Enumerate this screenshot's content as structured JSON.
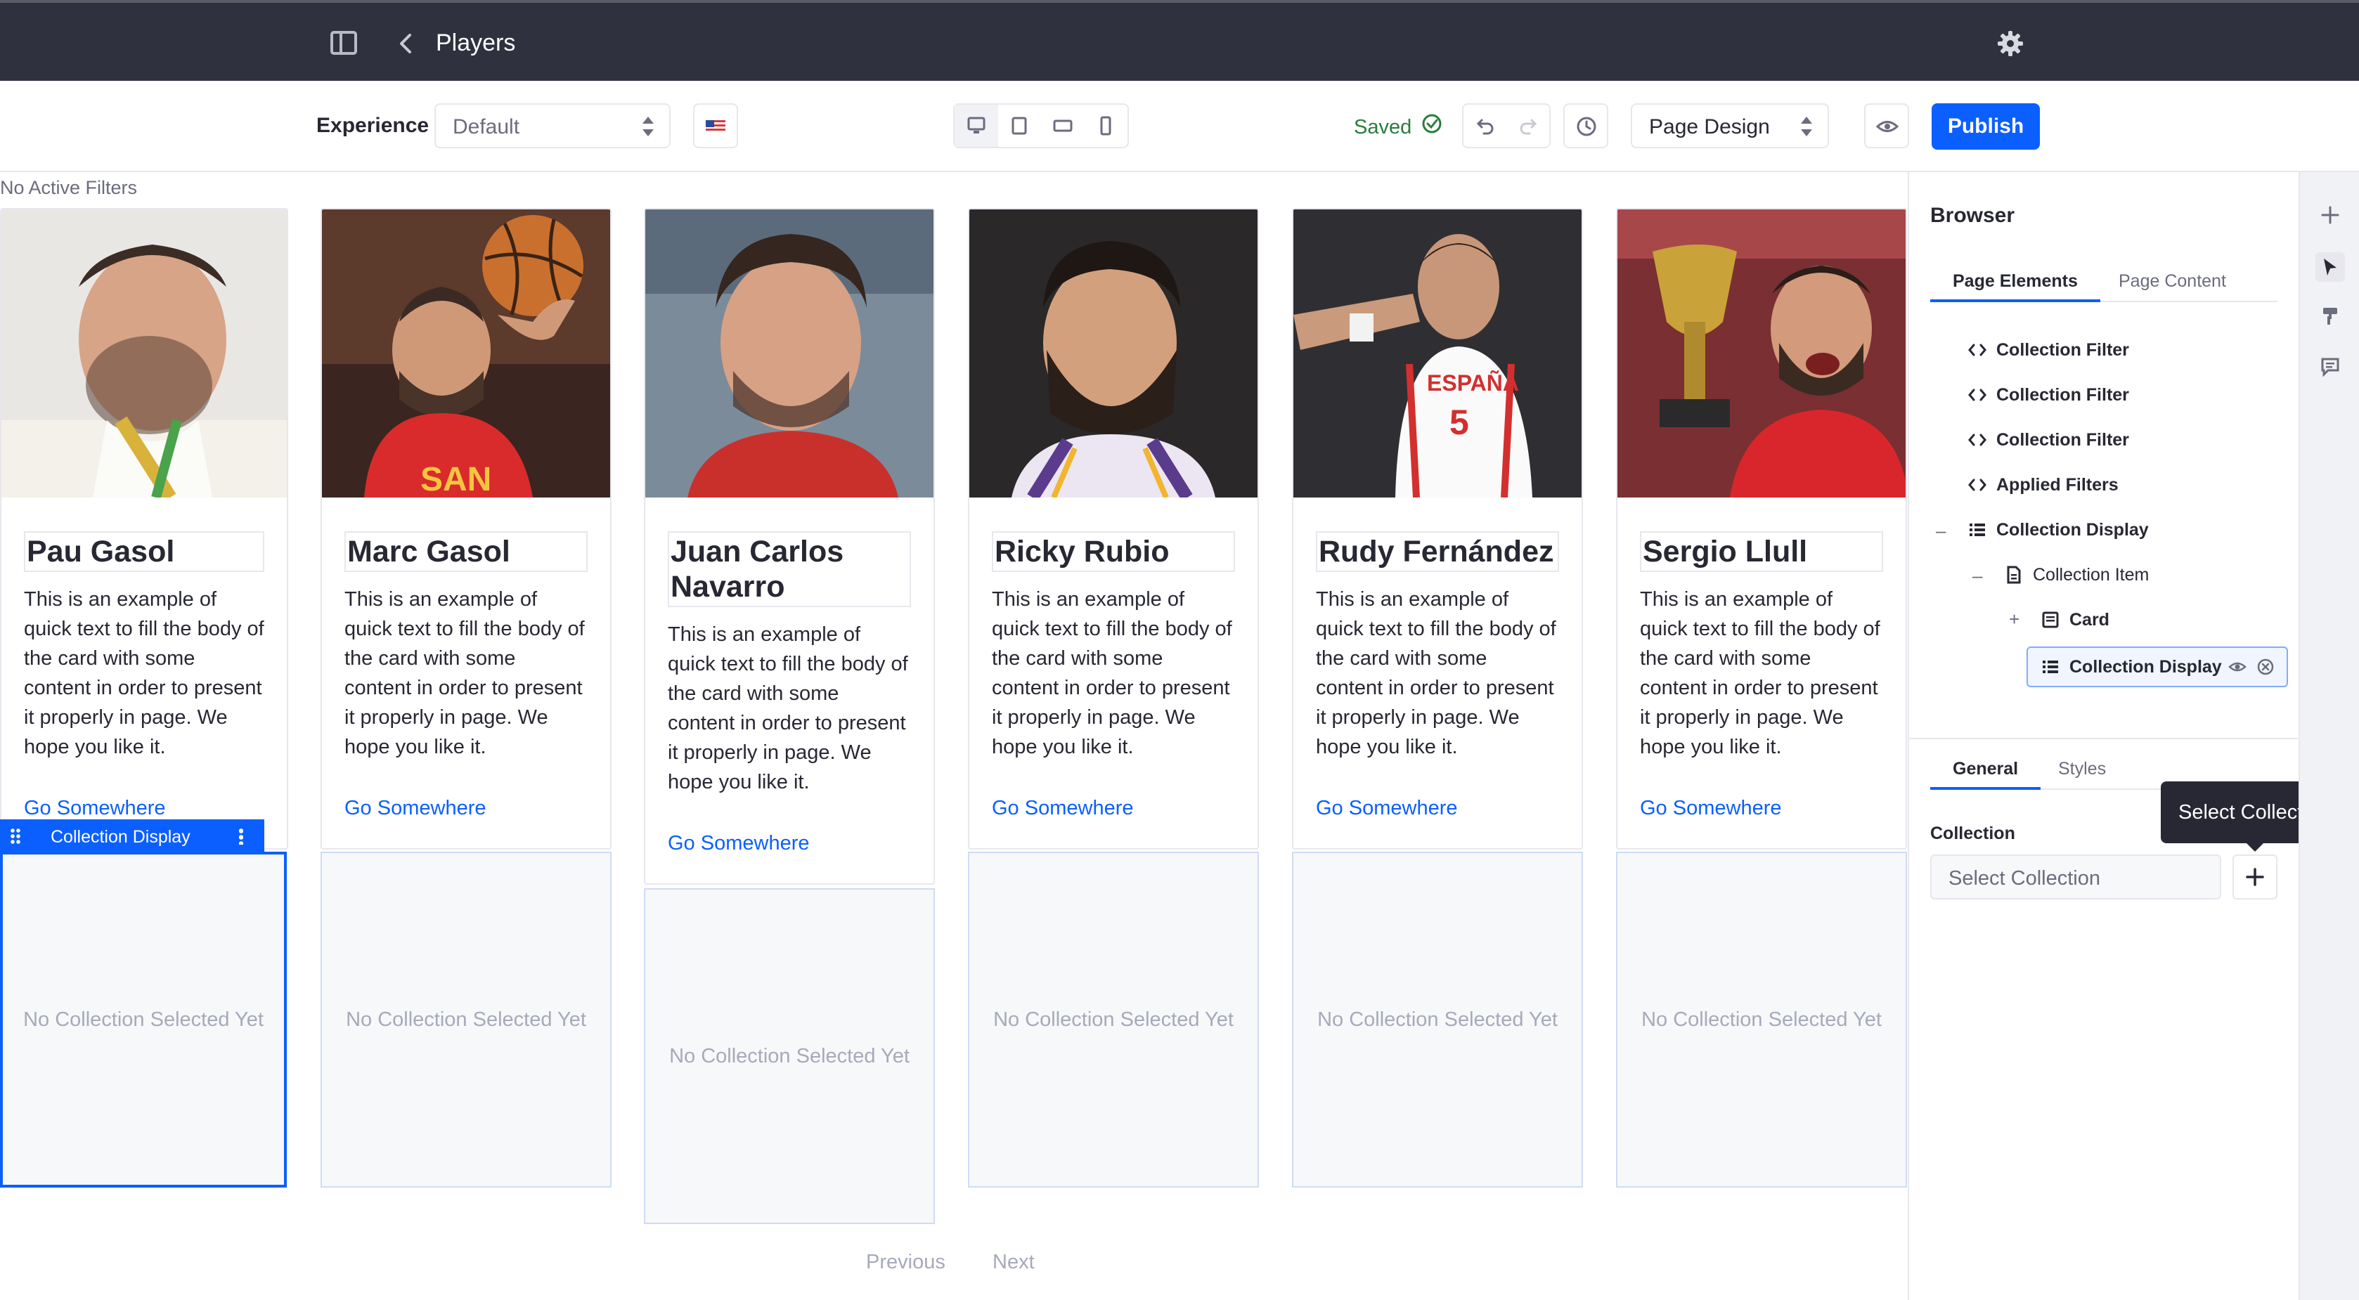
{
  "topbar": {
    "title": "Players"
  },
  "toolbar": {
    "experience_label": "Experience",
    "experience_value": "Default",
    "saved_label": "Saved",
    "mode_value": "Page Design",
    "publish_label": "Publish"
  },
  "canvas": {
    "filters_status": "No Active Filters",
    "cards": [
      {
        "name": "Pau Gasol",
        "text": "This is an example of quick text to fill the body of the card with some content in order to present it properly in page. We hope you like it.",
        "link": "Go Somewhere"
      },
      {
        "name": "Marc Gasol",
        "text": "This is an example of quick text to fill the body of the card with some content in order to present it properly in page. We hope you like it.",
        "link": "Go Somewhere"
      },
      {
        "name": "Juan Carlos Navarro",
        "text": "This is an example of quick text to fill the body of the card with some content in order to present it properly in page. We hope you like it.",
        "link": "Go Somewhere"
      },
      {
        "name": "Ricky Rubio",
        "text": "This is an example of quick text to fill the body of the card with some content in order to present it properly in page. We hope you like it.",
        "link": "Go Somewhere"
      },
      {
        "name": "Rudy Fernández",
        "text": "This is an example of quick text to fill the body of the card with some content in order to present it properly in page. We hope you like it.",
        "link": "Go Somewhere"
      },
      {
        "name": "Sergio Llull",
        "text": "This is an example of quick text to fill the body of the card with some content in order to present it properly in page. We hope you like it.",
        "link": "Go Somewhere"
      }
    ],
    "empty_state": "No Collection Selected Yet",
    "fragment_tag": "Collection Display",
    "pager": {
      "previous": "Previous",
      "next": "Next"
    }
  },
  "browser": {
    "title": "Browser",
    "tabs": [
      "Page Elements",
      "Page Content"
    ],
    "tree": [
      {
        "label": "Collection Filter"
      },
      {
        "label": "Collection Filter"
      },
      {
        "label": "Collection Filter"
      },
      {
        "label": "Applied Filters"
      },
      {
        "label": "Collection Display",
        "toggle": "–"
      },
      {
        "label": "Collection Item",
        "toggle": "–"
      },
      {
        "label": "Card",
        "toggle": "+"
      },
      {
        "label": "Collection Display"
      }
    ]
  },
  "config": {
    "tabs": [
      "General",
      "Styles"
    ],
    "collection_label": "Collection",
    "collection_placeholder": "Select Collection",
    "tooltip": "Select Collection"
  },
  "colors": {
    "accent": "#0b5fff",
    "topbar": "#30313f",
    "success": "#287d3c"
  }
}
